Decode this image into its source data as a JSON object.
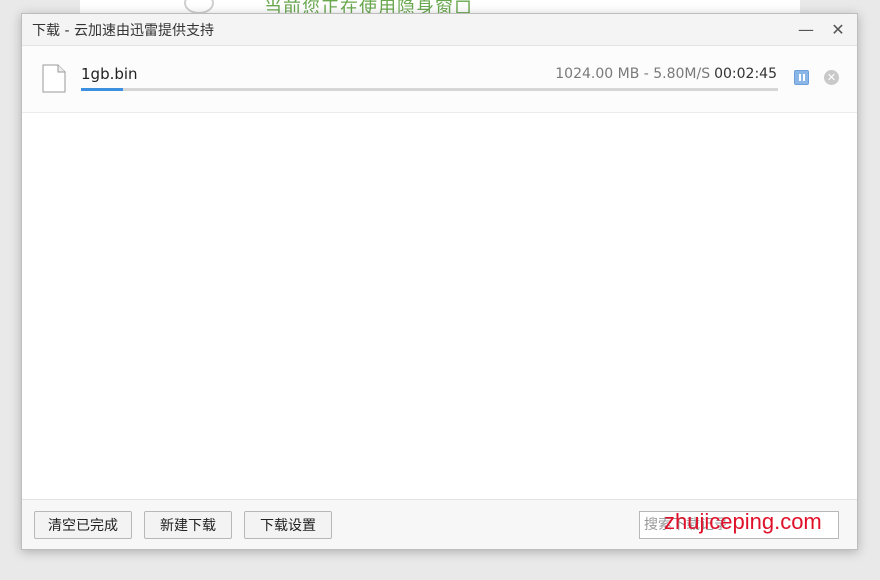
{
  "background_window": {
    "text": "当前您正在使用隐身窗口"
  },
  "dialog": {
    "title": "下载 - 云加速由迅雷提供支持",
    "minimize_glyph": "—",
    "close_glyph": "✕"
  },
  "downloads": [
    {
      "icon": "file-icon",
      "name": "1gb.bin",
      "size": "1024.00 MB",
      "separator": " - ",
      "speed": "5.80M/S",
      "time_remaining": "00:02:45",
      "progress": 0.06,
      "pause_icon": "pause-icon",
      "remove_icon": "close-circle-icon",
      "remove_glyph": "✕"
    }
  ],
  "footer": {
    "clear_label": "清空已完成",
    "new_label": "新建下载",
    "settings_label": "下载设置",
    "search_placeholder": "搜索下载记录"
  },
  "watermark": {
    "text": "zhujiceping.com"
  },
  "colors": {
    "progress": "#3d8fe0",
    "pause_button": "#8ab6e8",
    "watermark": "#e0102a",
    "backdrop_text": "#6aa84f"
  }
}
